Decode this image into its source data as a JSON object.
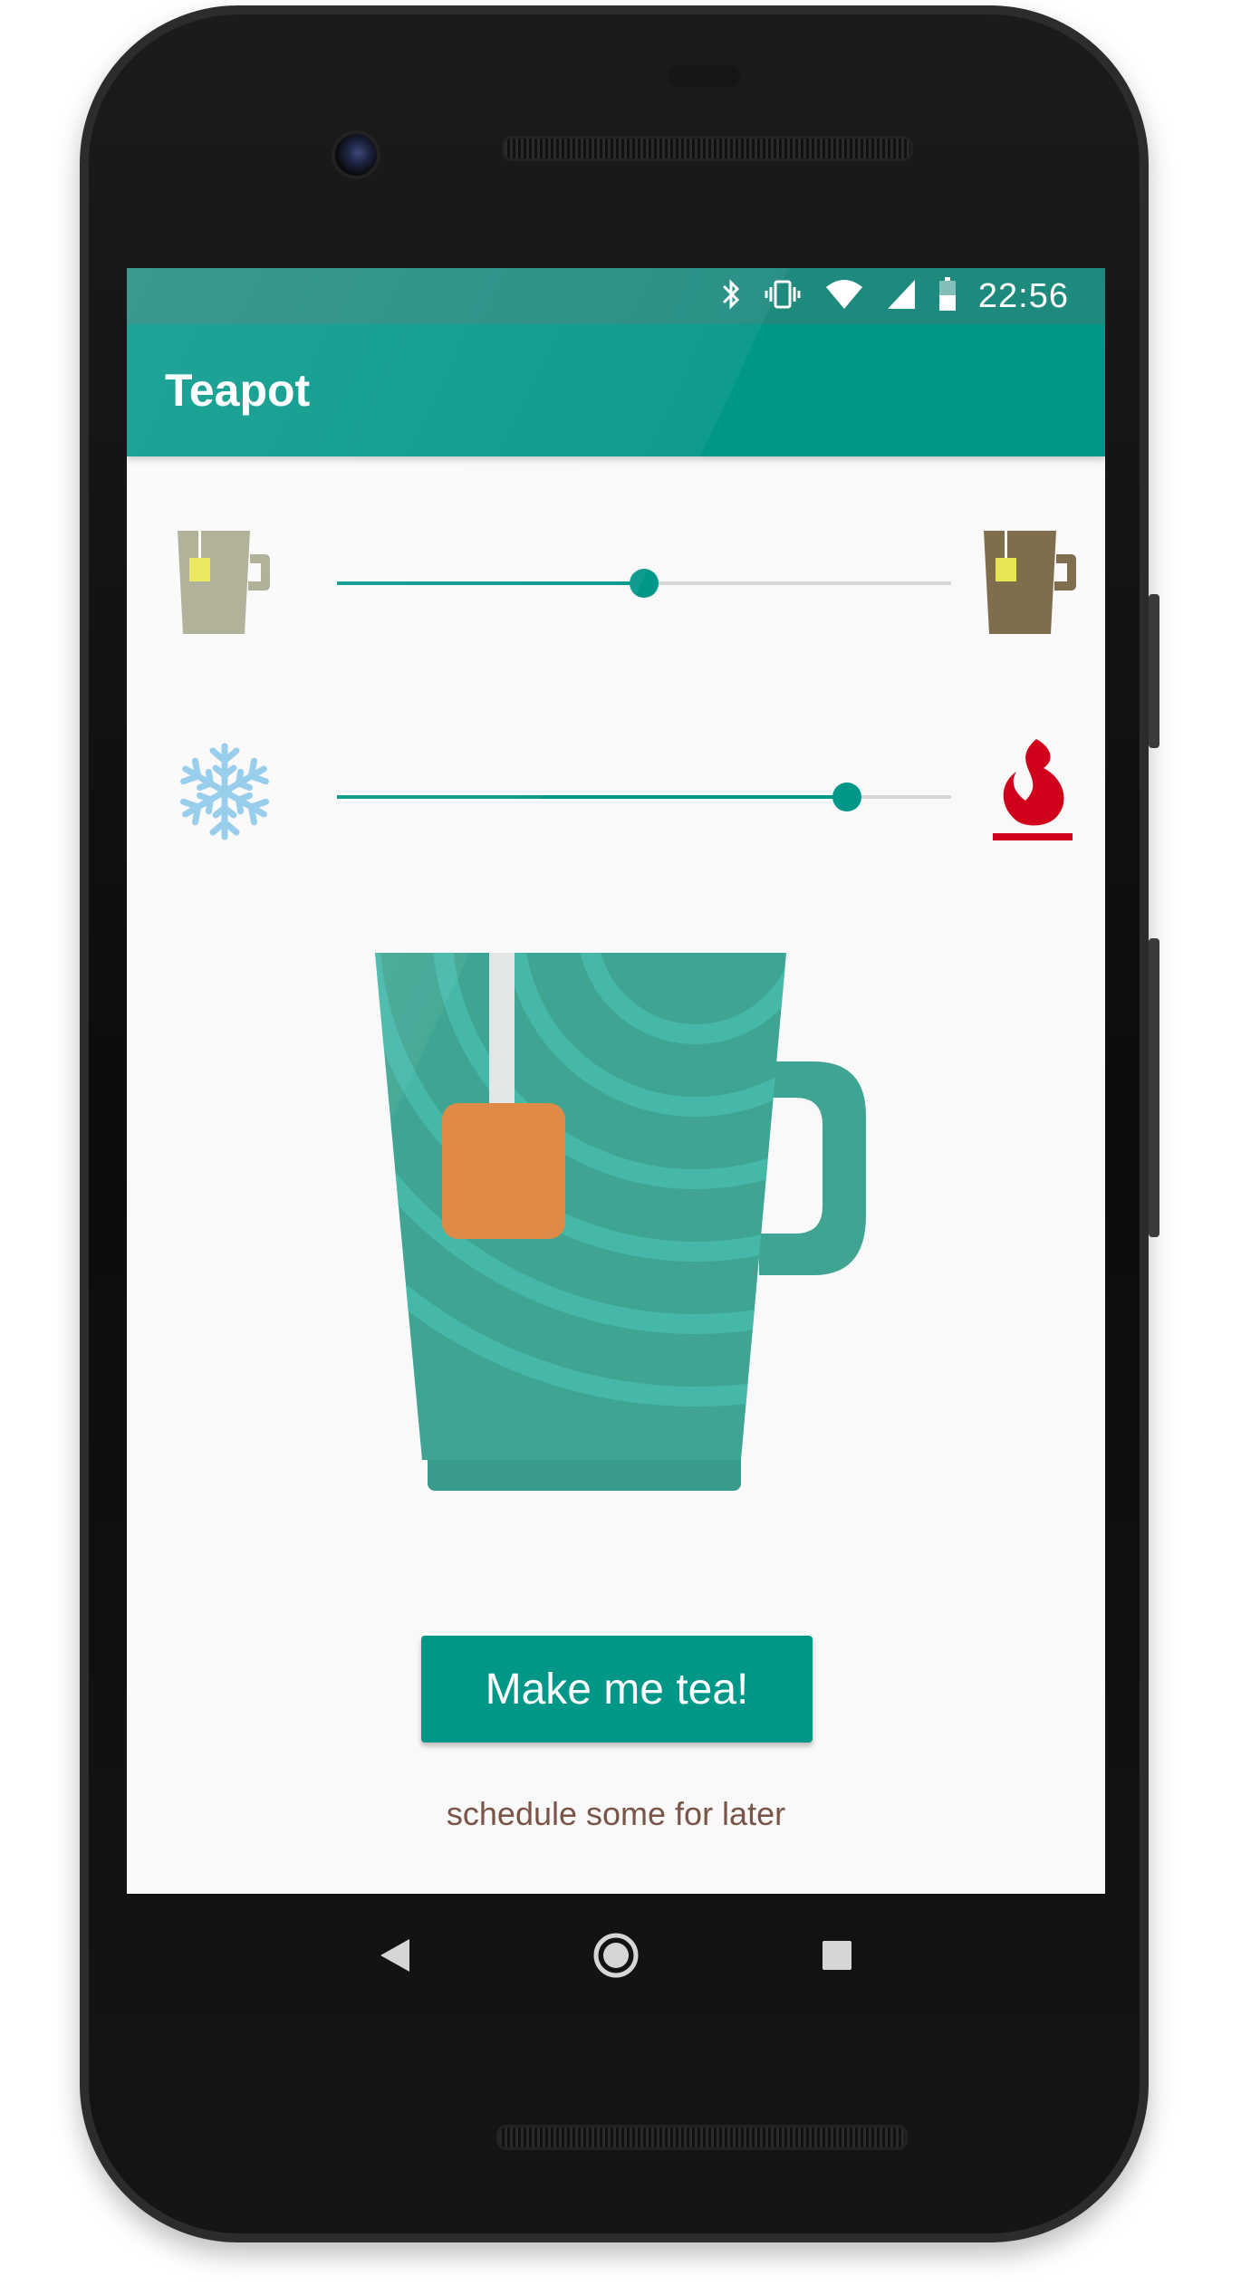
{
  "status_bar": {
    "time": "22:56",
    "icons": [
      "bluetooth-icon",
      "vibrate-icon",
      "wifi-icon",
      "cellular-signal-icon",
      "battery-icon"
    ]
  },
  "app_bar": {
    "title": "Teapot"
  },
  "strength_slider": {
    "value_fraction": 0.5,
    "left_icon": "weak-tea-mug-icon",
    "right_icon": "strong-tea-mug-icon"
  },
  "temperature_slider": {
    "value_fraction": 0.83,
    "left_icon": "snowflake-icon",
    "right_icon": "flame-icon"
  },
  "illustration": "tea-mug-illustration",
  "actions": {
    "make_tea_label": "Make me tea!",
    "schedule_label": "schedule some for later"
  },
  "nav_bar": {
    "icons": [
      "back-icon",
      "home-icon",
      "recents-icon"
    ]
  },
  "colors": {
    "primary": "#009688",
    "primary_dark": "#1e8a7e",
    "accent": "#009688",
    "link": "#795548",
    "flame": "#d0021b"
  }
}
